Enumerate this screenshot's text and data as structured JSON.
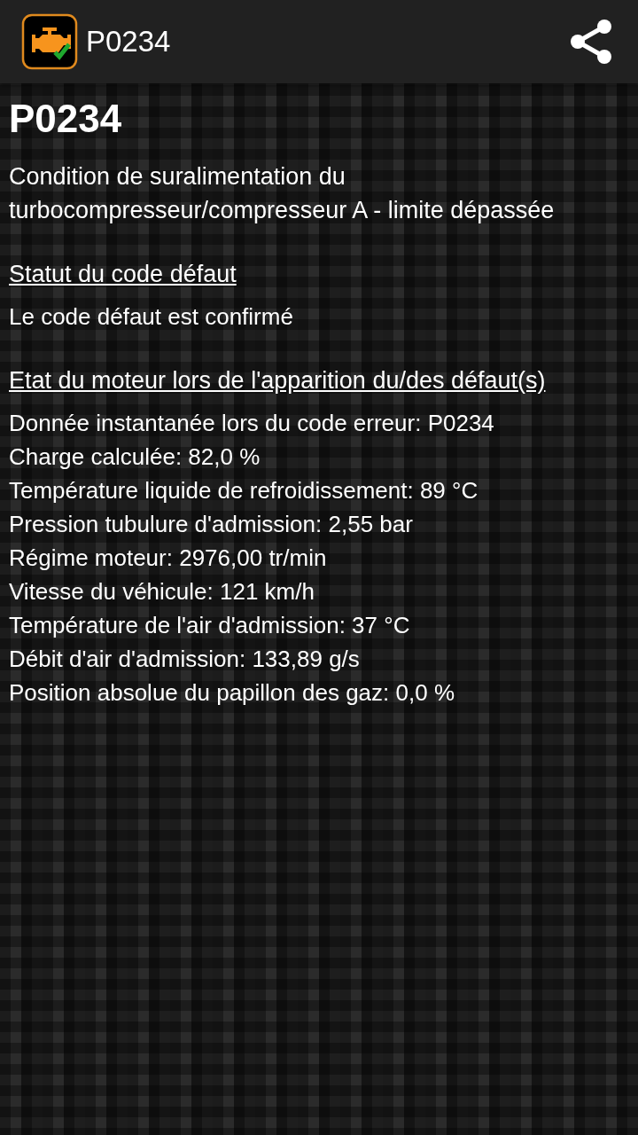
{
  "app_bar": {
    "title": "P0234"
  },
  "code": "P0234",
  "description": "Condition de suralimentation du turbocompresseur/compresseur A - limite dépassée",
  "sections": [
    {
      "heading": "Statut du code défaut",
      "lines": [
        "Le code défaut est confirmé"
      ]
    },
    {
      "heading": "Etat du moteur lors de l'apparition du/des défaut(s)",
      "lines": [
        "Donnée instantanée lors du code erreur: P0234",
        "Charge calculée: 82,0 %",
        "Température liquide de refroidissement: 89 °C",
        "Pression tubulure d'admission: 2,55 bar",
        "Régime moteur: 2976,00 tr/min",
        "Vitesse du véhicule: 121 km/h",
        "Température de l'air d'admission: 37 °C",
        "Débit d'air d'admission: 133,89 g/s",
        "Position absolue du papillon des gaz: 0,0 %"
      ]
    }
  ]
}
